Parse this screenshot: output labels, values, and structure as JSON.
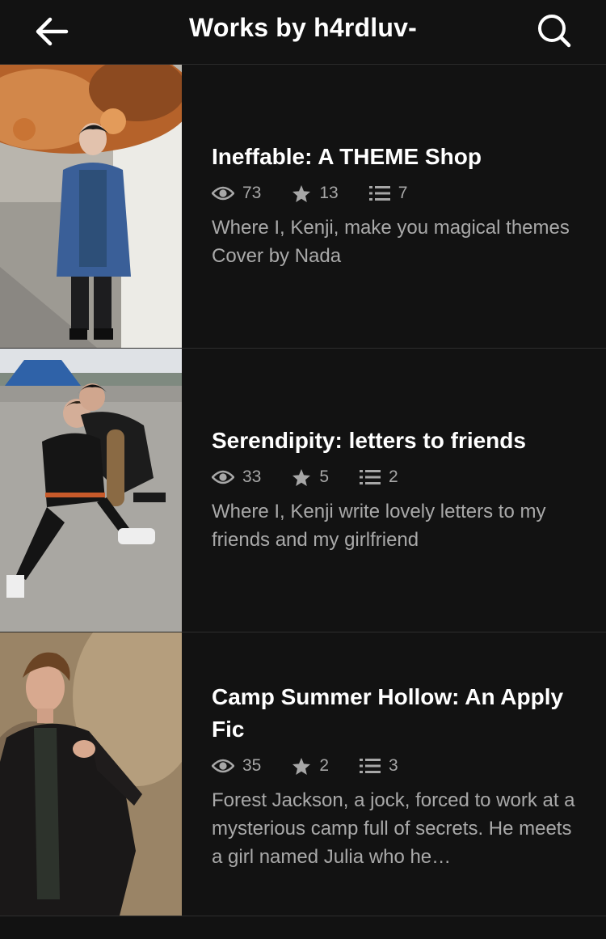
{
  "header": {
    "title": "Works by h4rdluv-"
  },
  "icons": {
    "back": "arrow-left-icon",
    "search": "search-icon",
    "views": "eye-icon",
    "votes": "star-icon",
    "parts": "list-icon"
  },
  "colors": {
    "background": "#121212",
    "text": "#ffffff",
    "muted": "#a9a9a9",
    "divider": "#2e2e2e"
  },
  "stories": [
    {
      "title": "Ineffable: A THEME Shop",
      "views": "73",
      "votes": "13",
      "parts": "7",
      "description": "Where I, Kenji, make you magical themes Cover by Nada"
    },
    {
      "title": "Serendipity: letters to friends",
      "views": "33",
      "votes": "5",
      "parts": "2",
      "description": "Where I, Kenji write lovely letters to my friends and my girlfriend"
    },
    {
      "title": "Camp Summer Hollow: An Apply Fic",
      "views": "35",
      "votes": "2",
      "parts": "3",
      "description": "Forest Jackson, a jock, forced to work at a mysterious camp full of secrets. He meets a girl named Julia who he…"
    }
  ]
}
